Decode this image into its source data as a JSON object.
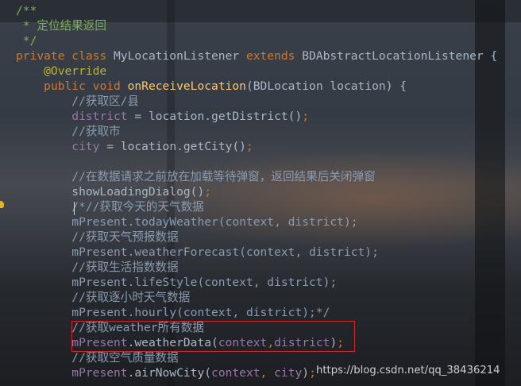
{
  "code_lines": [
    [
      {
        "t": "/**",
        "c": "doc"
      }
    ],
    [
      {
        "t": " * 定位结果返回",
        "c": "doc"
      }
    ],
    [
      {
        "t": " */",
        "c": "doc"
      }
    ],
    [
      {
        "t": "private class ",
        "c": "kw"
      },
      {
        "t": "MyLocationListener ",
        "c": "plain"
      },
      {
        "t": "extends ",
        "c": "kw"
      },
      {
        "t": "BDAbstractLocationListener {",
        "c": "plain"
      }
    ],
    [
      {
        "t": "    @Override",
        "c": "ann"
      }
    ],
    [
      {
        "t": "    ",
        "c": "plain"
      },
      {
        "t": "public void ",
        "c": "kw"
      },
      {
        "t": "onReceiveLocation",
        "c": "fn"
      },
      {
        "t": "(BDLocation location) {",
        "c": "plain"
      }
    ],
    [
      {
        "t": "        //获取区/县",
        "c": "comment"
      }
    ],
    [
      {
        "t": "        ",
        "c": "plain"
      },
      {
        "t": "district",
        "c": "fld"
      },
      {
        "t": " = location.getDistrict()",
        "c": "plain"
      },
      {
        "t": ";",
        "c": "kw"
      }
    ],
    [
      {
        "t": "        //获取市",
        "c": "comment"
      }
    ],
    [
      {
        "t": "        ",
        "c": "plain"
      },
      {
        "t": "city",
        "c": "fld"
      },
      {
        "t": " = location.getCity()",
        "c": "plain"
      },
      {
        "t": ";",
        "c": "kw"
      }
    ],
    [
      {
        "t": "",
        "c": "plain"
      }
    ],
    [
      {
        "t": "        //在数据请求之前放在加载等待弹窗，返回结果后关闭弹窗",
        "c": "comment"
      }
    ],
    [
      {
        "t": "        showLoadingDialog()",
        "c": "plain"
      },
      {
        "t": ";",
        "c": "kw"
      }
    ],
    [
      {
        "t": "        /*//获取今天的天气数据",
        "c": "comment"
      }
    ],
    [
      {
        "t": "        mPresent.todayWeather(context, district);",
        "c": "comment"
      }
    ],
    [
      {
        "t": "        //获取天气预报数据",
        "c": "comment"
      }
    ],
    [
      {
        "t": "        mPresent.weatherForecast(context, district);",
        "c": "comment"
      }
    ],
    [
      {
        "t": "        //获取生活指数数据",
        "c": "comment"
      }
    ],
    [
      {
        "t": "        mPresent.lifeStyle(context, district);",
        "c": "comment"
      }
    ],
    [
      {
        "t": "        //获取逐小时天气数据",
        "c": "comment"
      }
    ],
    [
      {
        "t": "        mPresent.hourly(context, district);*/",
        "c": "comment"
      }
    ],
    [
      {
        "t": "        //获取weather所有数据",
        "c": "comment"
      }
    ],
    [
      {
        "t": "        ",
        "c": "plain"
      },
      {
        "t": "mPresent",
        "c": "fld"
      },
      {
        "t": ".weatherData(",
        "c": "plain"
      },
      {
        "t": "context",
        "c": "fld"
      },
      {
        "t": ",",
        "c": "kw"
      },
      {
        "t": "district",
        "c": "fld"
      },
      {
        "t": ")",
        "c": "plain"
      },
      {
        "t": ";",
        "c": "kw"
      }
    ],
    [
      {
        "t": "        //获取空气质量数据",
        "c": "comment"
      }
    ],
    [
      {
        "t": "        ",
        "c": "plain"
      },
      {
        "t": "mPresent",
        "c": "fld"
      },
      {
        "t": ".airNowCity(",
        "c": "plain"
      },
      {
        "t": "context",
        "c": "fld"
      },
      {
        "t": ", ",
        "c": "kw"
      },
      {
        "t": "city",
        "c": "fld"
      },
      {
        "t": ")",
        "c": "plain"
      },
      {
        "t": ";",
        "c": "kw"
      }
    ]
  ],
  "watermark": "https://blog.csdn.net/qq_38436214",
  "colors": {
    "highlight_border": "#d0282c",
    "keyword": "#cc7832",
    "annotation": "#bbb529",
    "method": "#ffc66d",
    "field": "#9876aa"
  }
}
